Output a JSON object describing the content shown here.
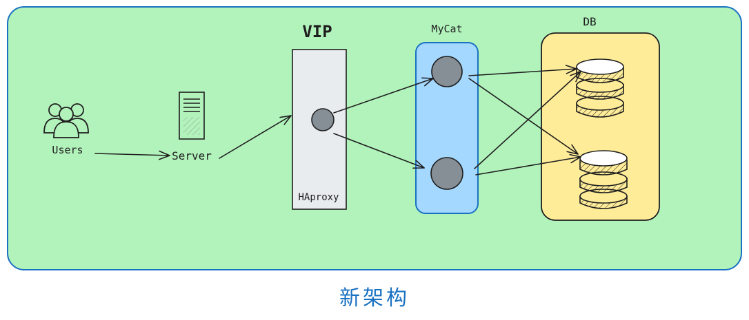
{
  "colors": {
    "panel_fill": "#b2f2bb",
    "panel_stroke": "#1971c2",
    "haproxy_fill": "#e9ecef",
    "mycat_fill": "#a5d8ff",
    "db_fill": "#ffec99",
    "node_fill": "#868e96",
    "stroke": "#1e1e1e",
    "caption": "#1971c2"
  },
  "labels": {
    "users": "Users",
    "server": "Server",
    "vip": "VIP",
    "haproxy": "HAproxy",
    "mycat": "MyCat",
    "db": "DB"
  },
  "caption": "新架构",
  "icons": [
    "users-icon",
    "server-icon",
    "database-icon"
  ]
}
